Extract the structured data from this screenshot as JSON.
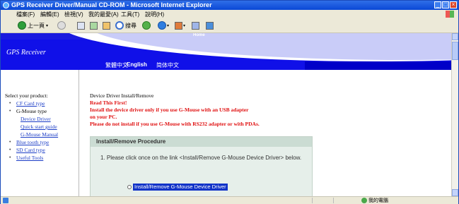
{
  "window": {
    "title": "GPS Receiver Driver/Manual CD-ROM - Microsoft Internet Explorer",
    "minimize": "_",
    "maximize": "□",
    "close": "×"
  },
  "menu": {
    "items": [
      "檔案(F)",
      "編輯(E)",
      "檢視(V)",
      "我的最愛(A)",
      "工具(T)",
      "說明(H)"
    ]
  },
  "toolbar": {
    "back_label": "上一頁",
    "search_label": "搜尋",
    "icons": [
      "back-icon",
      "forward-icon",
      "stop-icon",
      "refresh-icon",
      "home-icon",
      "search-icon",
      "favorites-icon",
      "media-icon",
      "mail-icon",
      "print-icon",
      "edit-icon",
      "messenger-icon"
    ]
  },
  "banner": {
    "home_label": "Home",
    "logo_text": "GPS Receiver"
  },
  "languages": {
    "items": [
      "繁體中文",
      "English",
      "简体中文"
    ],
    "active": "English"
  },
  "sidebar": {
    "heading": "Select your product:",
    "items": [
      {
        "label": "CF Card type",
        "link": true
      },
      {
        "label": "G-Mouse type",
        "link": false
      },
      {
        "label": "Device Driver",
        "link": true,
        "sub": true
      },
      {
        "label": "Quick start guide",
        "link": true,
        "sub": true
      },
      {
        "label": "G-Mouse Manual",
        "link": true,
        "sub": true
      },
      {
        "label": "Blue tooth type",
        "link": true
      },
      {
        "label": "SD Card type",
        "link": true
      },
      {
        "label": "Useful Tools",
        "link": true
      }
    ]
  },
  "content": {
    "heading": "Device Driver Install/Remove",
    "warning_lines": [
      "Read This First!",
      "Install the device driver only if you use G-Mouse with an USB adapter",
      "on your PC.",
      "Please do not install if you use G-Mouse with RS232 adapter or with PDAs."
    ],
    "panel_title": "Install/Remove Procedure",
    "step_text": "1.  Please click once on the link <Install/Remove G-Mouse Device Driver> below.",
    "selected_link": "Install/Remove G-Mouse Device Driver"
  },
  "status": {
    "zone": "我的電腦"
  }
}
